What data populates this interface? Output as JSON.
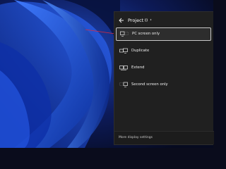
{
  "project_panel": {
    "title": "Project",
    "back_icon": "arrow-left-icon",
    "options": [
      {
        "label": "PC screen only",
        "icon": "pc-screen-only-icon",
        "selected": true
      },
      {
        "label": "Duplicate",
        "icon": "duplicate-icon",
        "selected": false
      },
      {
        "label": "Extend",
        "icon": "extend-icon",
        "selected": false
      },
      {
        "label": "Second screen only",
        "icon": "second-screen-only-icon",
        "selected": false
      }
    ],
    "footer_link": "More display settings"
  },
  "colors": {
    "panel_bg": "#202020",
    "selected_bg": "#2d2d2d",
    "selected_border": "#c8c8c8",
    "annotation_line": "#e02a3c",
    "wallpaper_blue": "#1f54d8"
  }
}
